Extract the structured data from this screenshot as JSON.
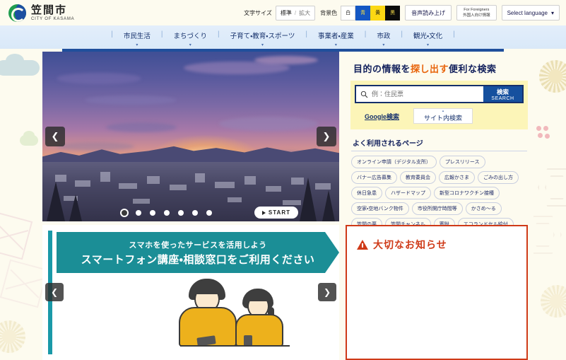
{
  "header": {
    "logo_jp": "笠間市",
    "logo_en": "CITY OF KASAMA",
    "text_size_label": "文字サイズ",
    "text_size_standard": "標準",
    "text_size_separator": "/",
    "text_size_large": "拡大",
    "bg_color_label": "背景色",
    "bg_white": "白",
    "bg_blue": "青",
    "bg_yellow": "黄",
    "bg_black": "黒",
    "speech_label": "音声読み上げ",
    "foreigners_en": "For Foreigners",
    "foreigners_jp": "外国人向け情報",
    "language_label": "Select language",
    "language_caret": "▾"
  },
  "nav": {
    "separator": "|",
    "items": [
      {
        "label": "市民生活",
        "caret": "▾"
      },
      {
        "label": "まちづくり",
        "caret": "▾"
      },
      {
        "label": "子育て・教育・スポーツ",
        "caret": "▾"
      },
      {
        "label": "事業者・産業",
        "caret": "▾"
      },
      {
        "label": "市政",
        "caret": "▾"
      },
      {
        "label": "観光・文化",
        "caret": "▾"
      }
    ]
  },
  "hero": {
    "prev_arrow": "❮",
    "next_arrow": "❯",
    "start_label": "START",
    "slide_count": 7,
    "active_slide": 1
  },
  "search": {
    "title_plain_1": "目的の情報を",
    "title_highlight": "探し出す",
    "title_plain_2": "便利な検索",
    "placeholder": "例：住民票",
    "value": "",
    "button_jp": "検索",
    "button_en": "SEARCH",
    "tab_google": "Google検索",
    "tab_site": "サイト内検索",
    "tab_site_caret": "▴",
    "frequent_title": "よく利用されるページ",
    "tags": [
      "オンライン申請（デジタル支所）",
      "プレスリリース",
      "バナー広告募集",
      "教育委員会",
      "広報かさま",
      "ごみの出し方",
      "休日急患",
      "ハザードマップ",
      "新型コロナワクチン接種",
      "空家・空地バンク物件",
      "市役所開庁時間等",
      "かさめ〜る",
      "笠間の栗",
      "笠間チャンネル",
      "寄附",
      "エコランドセル給付"
    ]
  },
  "banner": {
    "line1": "スマホを使ったサービスを活用しよう",
    "line2": "スマートフォン講座・相談窓口をご利用ください",
    "prev_arrow": "❮",
    "next_arrow": "❯"
  },
  "notice": {
    "title": "大切なお知らせ"
  }
}
